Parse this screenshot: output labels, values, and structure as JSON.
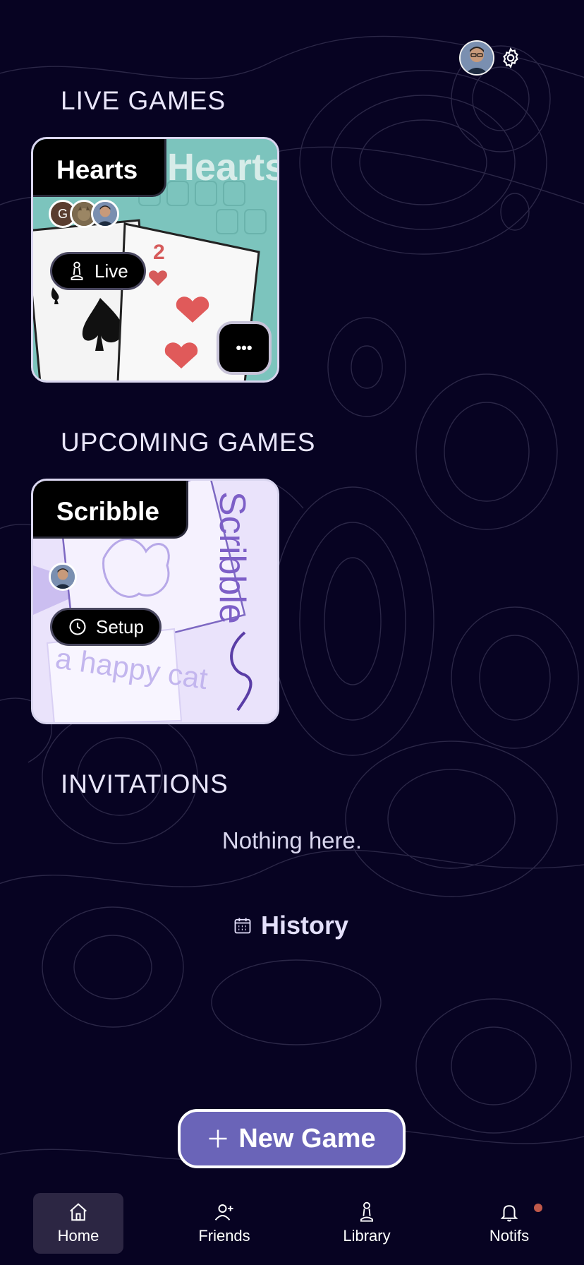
{
  "header": {
    "avatar_icon": "user-avatar",
    "settings_icon": "gear-icon"
  },
  "sections": {
    "live": "LIVE GAMES",
    "upcoming": "UPCOMING GAMES",
    "invitations": "INVITATIONS"
  },
  "live_game": {
    "title": "Hearts",
    "art_text": "Hearts",
    "card_rank": "2",
    "player_initial": "G",
    "status": "Live",
    "more_label": "•••"
  },
  "upcoming_game": {
    "title": "Scribble",
    "art_text": "Scribble",
    "prompt_text": "a happy cat",
    "status": "Setup"
  },
  "invitations": {
    "empty_text": "Nothing here."
  },
  "history": {
    "label": "History"
  },
  "new_game": {
    "label": "New Game"
  },
  "nav": {
    "home": "Home",
    "friends": "Friends",
    "library": "Library",
    "notifs": "Notifs"
  },
  "colors": {
    "background": "#070322",
    "accent": "#6a64b8",
    "hearts_bg": "#7cc4bd",
    "scribble_bg": "#eae3fb",
    "notif_dot": "#c0594a"
  }
}
